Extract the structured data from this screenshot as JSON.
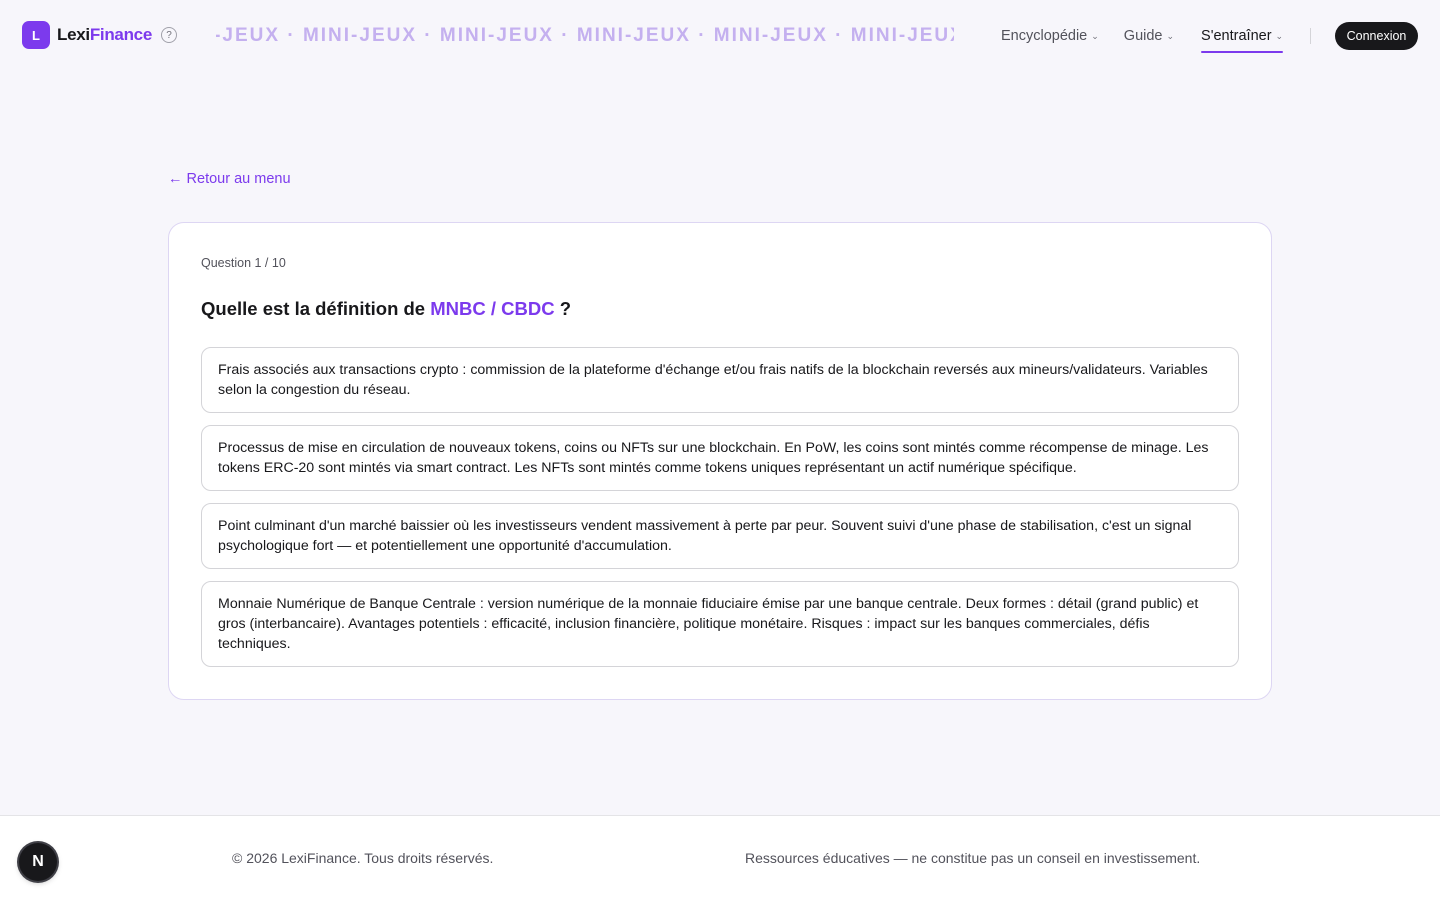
{
  "header": {
    "logo_letter": "L",
    "brand_part1": "Lexi",
    "brand_part2": "Finance",
    "help": "?",
    "marquee": "MINI-JEUX · MINI-JEUX · MINI-JEUX · MINI-JEUX · MINI-JEUX · MINI-JEUX · MINI-JEUX",
    "nav": [
      {
        "label": "Encyclopédie",
        "icon": "chevron-down-icon"
      },
      {
        "label": "Guide",
        "icon": "chevron-down-icon"
      },
      {
        "label": "S'entraîner",
        "icon": "chevron-down-icon",
        "active": true
      }
    ],
    "login_label": "Connexion"
  },
  "back_link": "← Retour au menu",
  "quiz": {
    "counter": "Question 1 / 10",
    "prompt_before": "Quelle est la définition de",
    "term": "MNBC / CBDC",
    "prompt_after": "?",
    "answers": [
      "Frais associés aux transactions crypto : commission de la plateforme d'échange et/ou frais natifs de la blockchain reversés aux mineurs/validateurs. Variables selon la congestion du réseau.",
      "Processus de mise en circulation de nouveaux tokens, coins ou NFTs sur une blockchain. En PoW, les coins sont mintés comme récompense de minage. Les tokens ERC-20 sont mintés via smart contract. Les NFTs sont mintés comme tokens uniques représentant un actif numérique spécifique.",
      "Point culminant d'un marché baissier où les investisseurs vendent massivement à perte par peur. Souvent suivi d'une phase de stabilisation, c'est un signal psychologique fort — et potentiellement une opportunité d'accumulation.",
      "Monnaie Numérique de Banque Centrale : version numérique de la monnaie fiduciaire émise par une banque centrale. Deux formes : détail (grand public) et gros (interbancaire). Avantages potentiels : efficacité, inclusion financière, politique monétaire. Risques : impact sur les banques commerciales, défis techniques."
    ]
  },
  "footer": {
    "copyright": "© 2026 LexiFinance. Tous droits réservés.",
    "disclaimer": "Ressources éducatives — ne constitue pas un conseil en investissement."
  },
  "dev_badge": "N",
  "colors": {
    "accent": "#7c3aed",
    "accent_light": "#c4b0ef",
    "dark": "#18181b",
    "background": "#f7f6fb"
  }
}
